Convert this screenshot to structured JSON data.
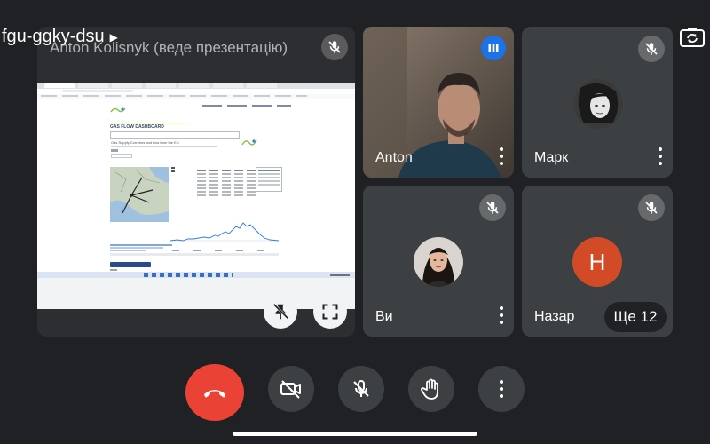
{
  "meeting": {
    "code": "fgu-ggky-dsu",
    "presentation_title": "Anton Kolisnyk (веде презентацію)"
  },
  "shared_screen": {
    "heading": "GAS FLOW DASHBOARD",
    "subheading": "Gas Supply Corridors and flow from the EU"
  },
  "participants": [
    {
      "name": "Anton",
      "state": "speaking"
    },
    {
      "name": "Марк",
      "state": "muted"
    },
    {
      "name": "Ви",
      "state": "muted"
    },
    {
      "name": "Назар",
      "avatar_letter": "H",
      "state": "muted"
    }
  ],
  "overflow": {
    "label": "Ще 12"
  },
  "colors": {
    "background": "#202124",
    "tile": "#3c4043",
    "end_call": "#ea4335",
    "speaking_badge": "#1a73e8",
    "nazar_avatar": "#d24b26"
  },
  "icons": {
    "switch_camera": "camera-switch-icon",
    "mic_off": "mic-off-icon",
    "pin_off": "pin-off-icon",
    "fullscreen": "fullscreen-icon",
    "end_call": "end-call-icon",
    "camera_off": "camera-off-icon",
    "raise_hand": "hand-icon",
    "more": "more-vert-icon"
  }
}
